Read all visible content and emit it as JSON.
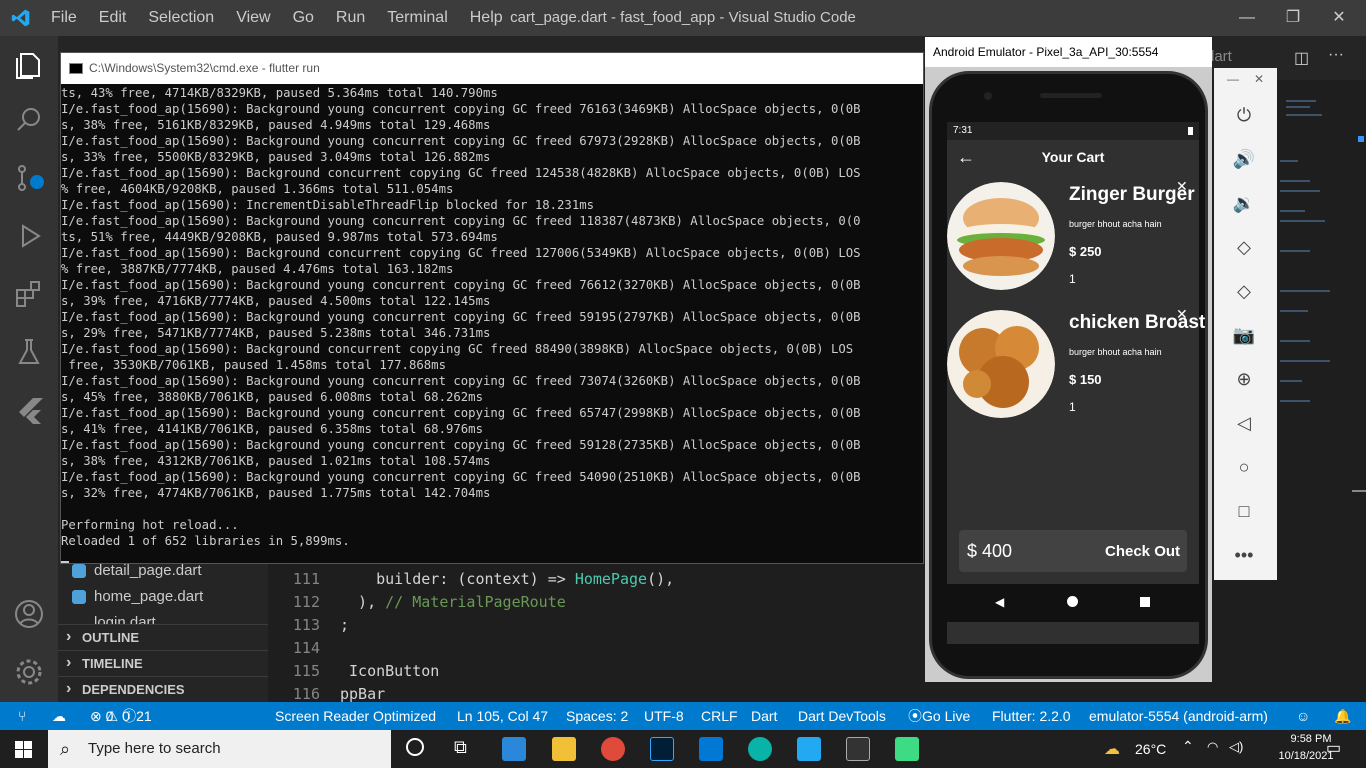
{
  "titlebar": {
    "menu": [
      "File",
      "Edit",
      "Selection",
      "View",
      "Go",
      "Run",
      "Terminal",
      "Help"
    ],
    "title": "cart_page.dart - fast_food_app - Visual Studio Code",
    "minimize": "—",
    "restore": "❐",
    "close": "✕"
  },
  "sidebar": {
    "files": [
      "detail_page.dart",
      "home_page.dart",
      "login.dart"
    ],
    "sections": [
      "OUTLINE",
      "TIMELINE",
      "DEPENDENCIES"
    ]
  },
  "editor": {
    "lines": [
      {
        "n": "111",
        "a": "    builder: (context) => ",
        "b": "HomePage",
        "c": "(),"
      },
      {
        "n": "112",
        "a": "  ), ",
        "b": "",
        "c": "// MaterialPageRoute"
      },
      {
        "n": "113",
        "a": ";",
        "b": "",
        "c": ""
      },
      {
        "n": "114",
        "a": "",
        "b": "",
        "c": ""
      },
      {
        "n": "115",
        "a": " IconButton",
        "b": "",
        "c": ""
      },
      {
        "n": "116",
        "a": "ppBar",
        "b": "",
        "c": ""
      }
    ],
    "tab_partial": "lart"
  },
  "cmd": {
    "title": "C:\\Windows\\System32\\cmd.exe - flutter  run",
    "output": "ts, 43% free, 4714KB/8329KB, paused 5.364ms total 140.790ms\nI/e.fast_food_ap(15690): Background young concurrent copying GC freed 76163(3469KB) AllocSpace objects, 0(0B\ns, 38% free, 5161KB/8329KB, paused 4.949ms total 129.468ms\nI/e.fast_food_ap(15690): Background young concurrent copying GC freed 67973(2928KB) AllocSpace objects, 0(0B\ns, 33% free, 5500KB/8329KB, paused 3.049ms total 126.882ms\nI/e.fast_food_ap(15690): Background concurrent copying GC freed 124538(4828KB) AllocSpace objects, 0(0B) LOS\n% free, 4604KB/9208KB, paused 1.366ms total 511.054ms\nI/e.fast_food_ap(15690): IncrementDisableThreadFlip blocked for 18.231ms\nI/e.fast_food_ap(15690): Background young concurrent copying GC freed 118387(4873KB) AllocSpace objects, 0(0\nts, 51% free, 4449KB/9208KB, paused 9.987ms total 573.694ms\nI/e.fast_food_ap(15690): Background concurrent copying GC freed 127006(5349KB) AllocSpace objects, 0(0B) LOS\n% free, 3887KB/7774KB, paused 4.476ms total 163.182ms\nI/e.fast_food_ap(15690): Background young concurrent copying GC freed 76612(3270KB) AllocSpace objects, 0(0B\ns, 39% free, 4716KB/7774KB, paused 4.500ms total 122.145ms\nI/e.fast_food_ap(15690): Background young concurrent copying GC freed 59195(2797KB) AllocSpace objects, 0(0B\ns, 29% free, 5471KB/7774KB, paused 5.238ms total 346.731ms\nI/e.fast_food_ap(15690): Background concurrent copying GC freed 88490(3898KB) AllocSpace objects, 0(0B) LOS\n free, 3530KB/7061KB, paused 1.458ms total 177.868ms\nI/e.fast_food_ap(15690): Background young concurrent copying GC freed 73074(3260KB) AllocSpace objects, 0(0B\ns, 45% free, 3880KB/7061KB, paused 6.008ms total 68.262ms\nI/e.fast_food_ap(15690): Background young concurrent copying GC freed 65747(2998KB) AllocSpace objects, 0(0B\ns, 41% free, 4141KB/7061KB, paused 6.358ms total 68.976ms\nI/e.fast_food_ap(15690): Background young concurrent copying GC freed 59128(2735KB) AllocSpace objects, 0(0B\ns, 38% free, 4312KB/7061KB, paused 1.021ms total 108.574ms\nI/e.fast_food_ap(15690): Background young concurrent copying GC freed 54090(2510KB) AllocSpace objects, 0(0B\ns, 32% free, 4774KB/7061KB, paused 1.775ms total 142.704ms\n\nPerforming hot reload...\nReloaded 1 of 652 libraries in 5,899ms."
  },
  "statusbar": {
    "errors": "0",
    "warnings": "0",
    "info": "21",
    "screen_reader": "Screen Reader Optimized",
    "position": "Ln 105, Col 47",
    "spaces": "Spaces: 2",
    "encoding": "UTF-8",
    "eol": "CRLF",
    "language": "Dart",
    "devtools": "Dart DevTools",
    "golive": "Go Live",
    "flutter": "Flutter: 2.2.0",
    "device": "emulator-5554 (android-arm)"
  },
  "emulator": {
    "title": "Android Emulator - Pixel_3a_API_30:5554",
    "time": "7:31",
    "appbar_title": "Your Cart",
    "items": [
      {
        "title": "Zinger Burger",
        "desc": "burger bhout acha hain",
        "price": "$ 250",
        "qty": "1"
      },
      {
        "title": "chicken Broast",
        "desc": "burger bhout acha hain",
        "price": "$ 150",
        "qty": "1"
      }
    ],
    "total": "$ 400",
    "checkout": "Check Out"
  },
  "taskbar": {
    "search_placeholder": "Type here to search",
    "temp": "26°C",
    "time": "9:58 PM",
    "date": "10/18/2021"
  },
  "colors": {
    "accent": "#007acc",
    "titlebar": "#3c3c3c"
  }
}
